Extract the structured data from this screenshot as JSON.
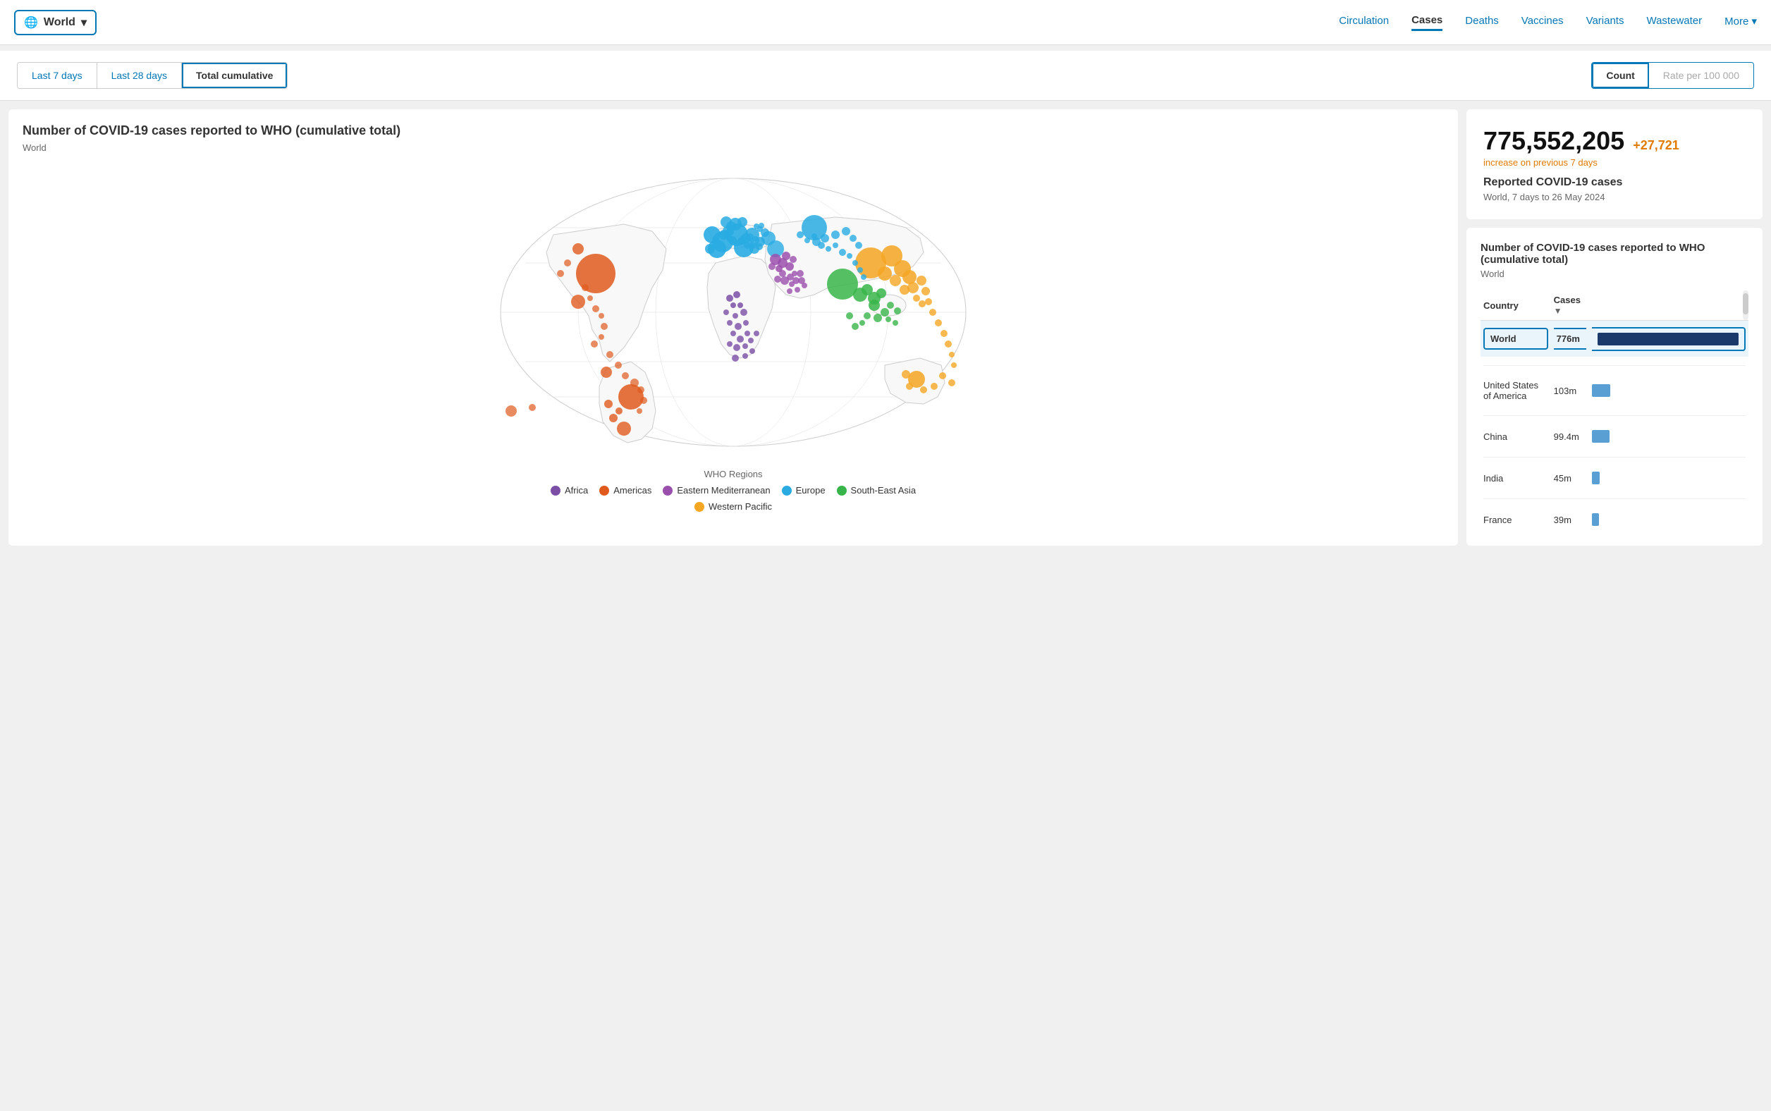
{
  "header": {
    "world_label": "World",
    "globe_icon": "🌐",
    "chevron_icon": "▾",
    "nav": [
      {
        "label": "Circulation",
        "active": false
      },
      {
        "label": "Cases",
        "active": true
      },
      {
        "label": "Deaths",
        "active": false
      },
      {
        "label": "Vaccines",
        "active": false
      },
      {
        "label": "Variants",
        "active": false
      },
      {
        "label": "Wastewater",
        "active": false
      },
      {
        "label": "More ▾",
        "active": false
      }
    ]
  },
  "filters": {
    "time_buttons": [
      {
        "label": "Last 7 days",
        "active": false
      },
      {
        "label": "Last 28 days",
        "active": false
      },
      {
        "label": "Total cumulative",
        "active": true
      }
    ],
    "count_label": "Count",
    "rate_label": "Rate per 100 000"
  },
  "map_panel": {
    "title": "Number of COVID-19 cases reported to WHO (cumulative total)",
    "subtitle": "World"
  },
  "legend": {
    "title": "WHO Regions",
    "items": [
      {
        "label": "Africa",
        "color": "#7b4fa6"
      },
      {
        "label": "Americas",
        "color": "#e05a1e"
      },
      {
        "label": "Eastern Mediterranean",
        "color": "#9b4fad"
      },
      {
        "label": "Europe",
        "color": "#29abe2"
      },
      {
        "label": "South-East Asia",
        "color": "#38b54a"
      },
      {
        "label": "Western Pacific",
        "color": "#f5a623"
      }
    ]
  },
  "stats": {
    "big_number": "775,552,205",
    "increase": "+27,721",
    "increase_label": "increase on previous 7 days",
    "reported_label": "Reported COVID-19 cases",
    "reported_sub": "World, 7 days to 26 May 2024"
  },
  "table": {
    "title": "Number of COVID-19 cases reported to WHO (cumulative total)",
    "subtitle": "World",
    "col_country": "Country",
    "col_cases": "Cases",
    "rows": [
      {
        "country": "World",
        "cases": "776m",
        "bar_class": "world",
        "highlighted": true
      },
      {
        "country": "United States of America",
        "cases": "103m",
        "bar_class": "usa",
        "highlighted": false
      },
      {
        "country": "China",
        "cases": "99.4m",
        "bar_class": "china",
        "highlighted": false
      },
      {
        "country": "India",
        "cases": "45m",
        "bar_class": "india",
        "highlighted": false
      },
      {
        "country": "France",
        "cases": "39m",
        "bar_class": "france",
        "highlighted": false
      }
    ]
  }
}
